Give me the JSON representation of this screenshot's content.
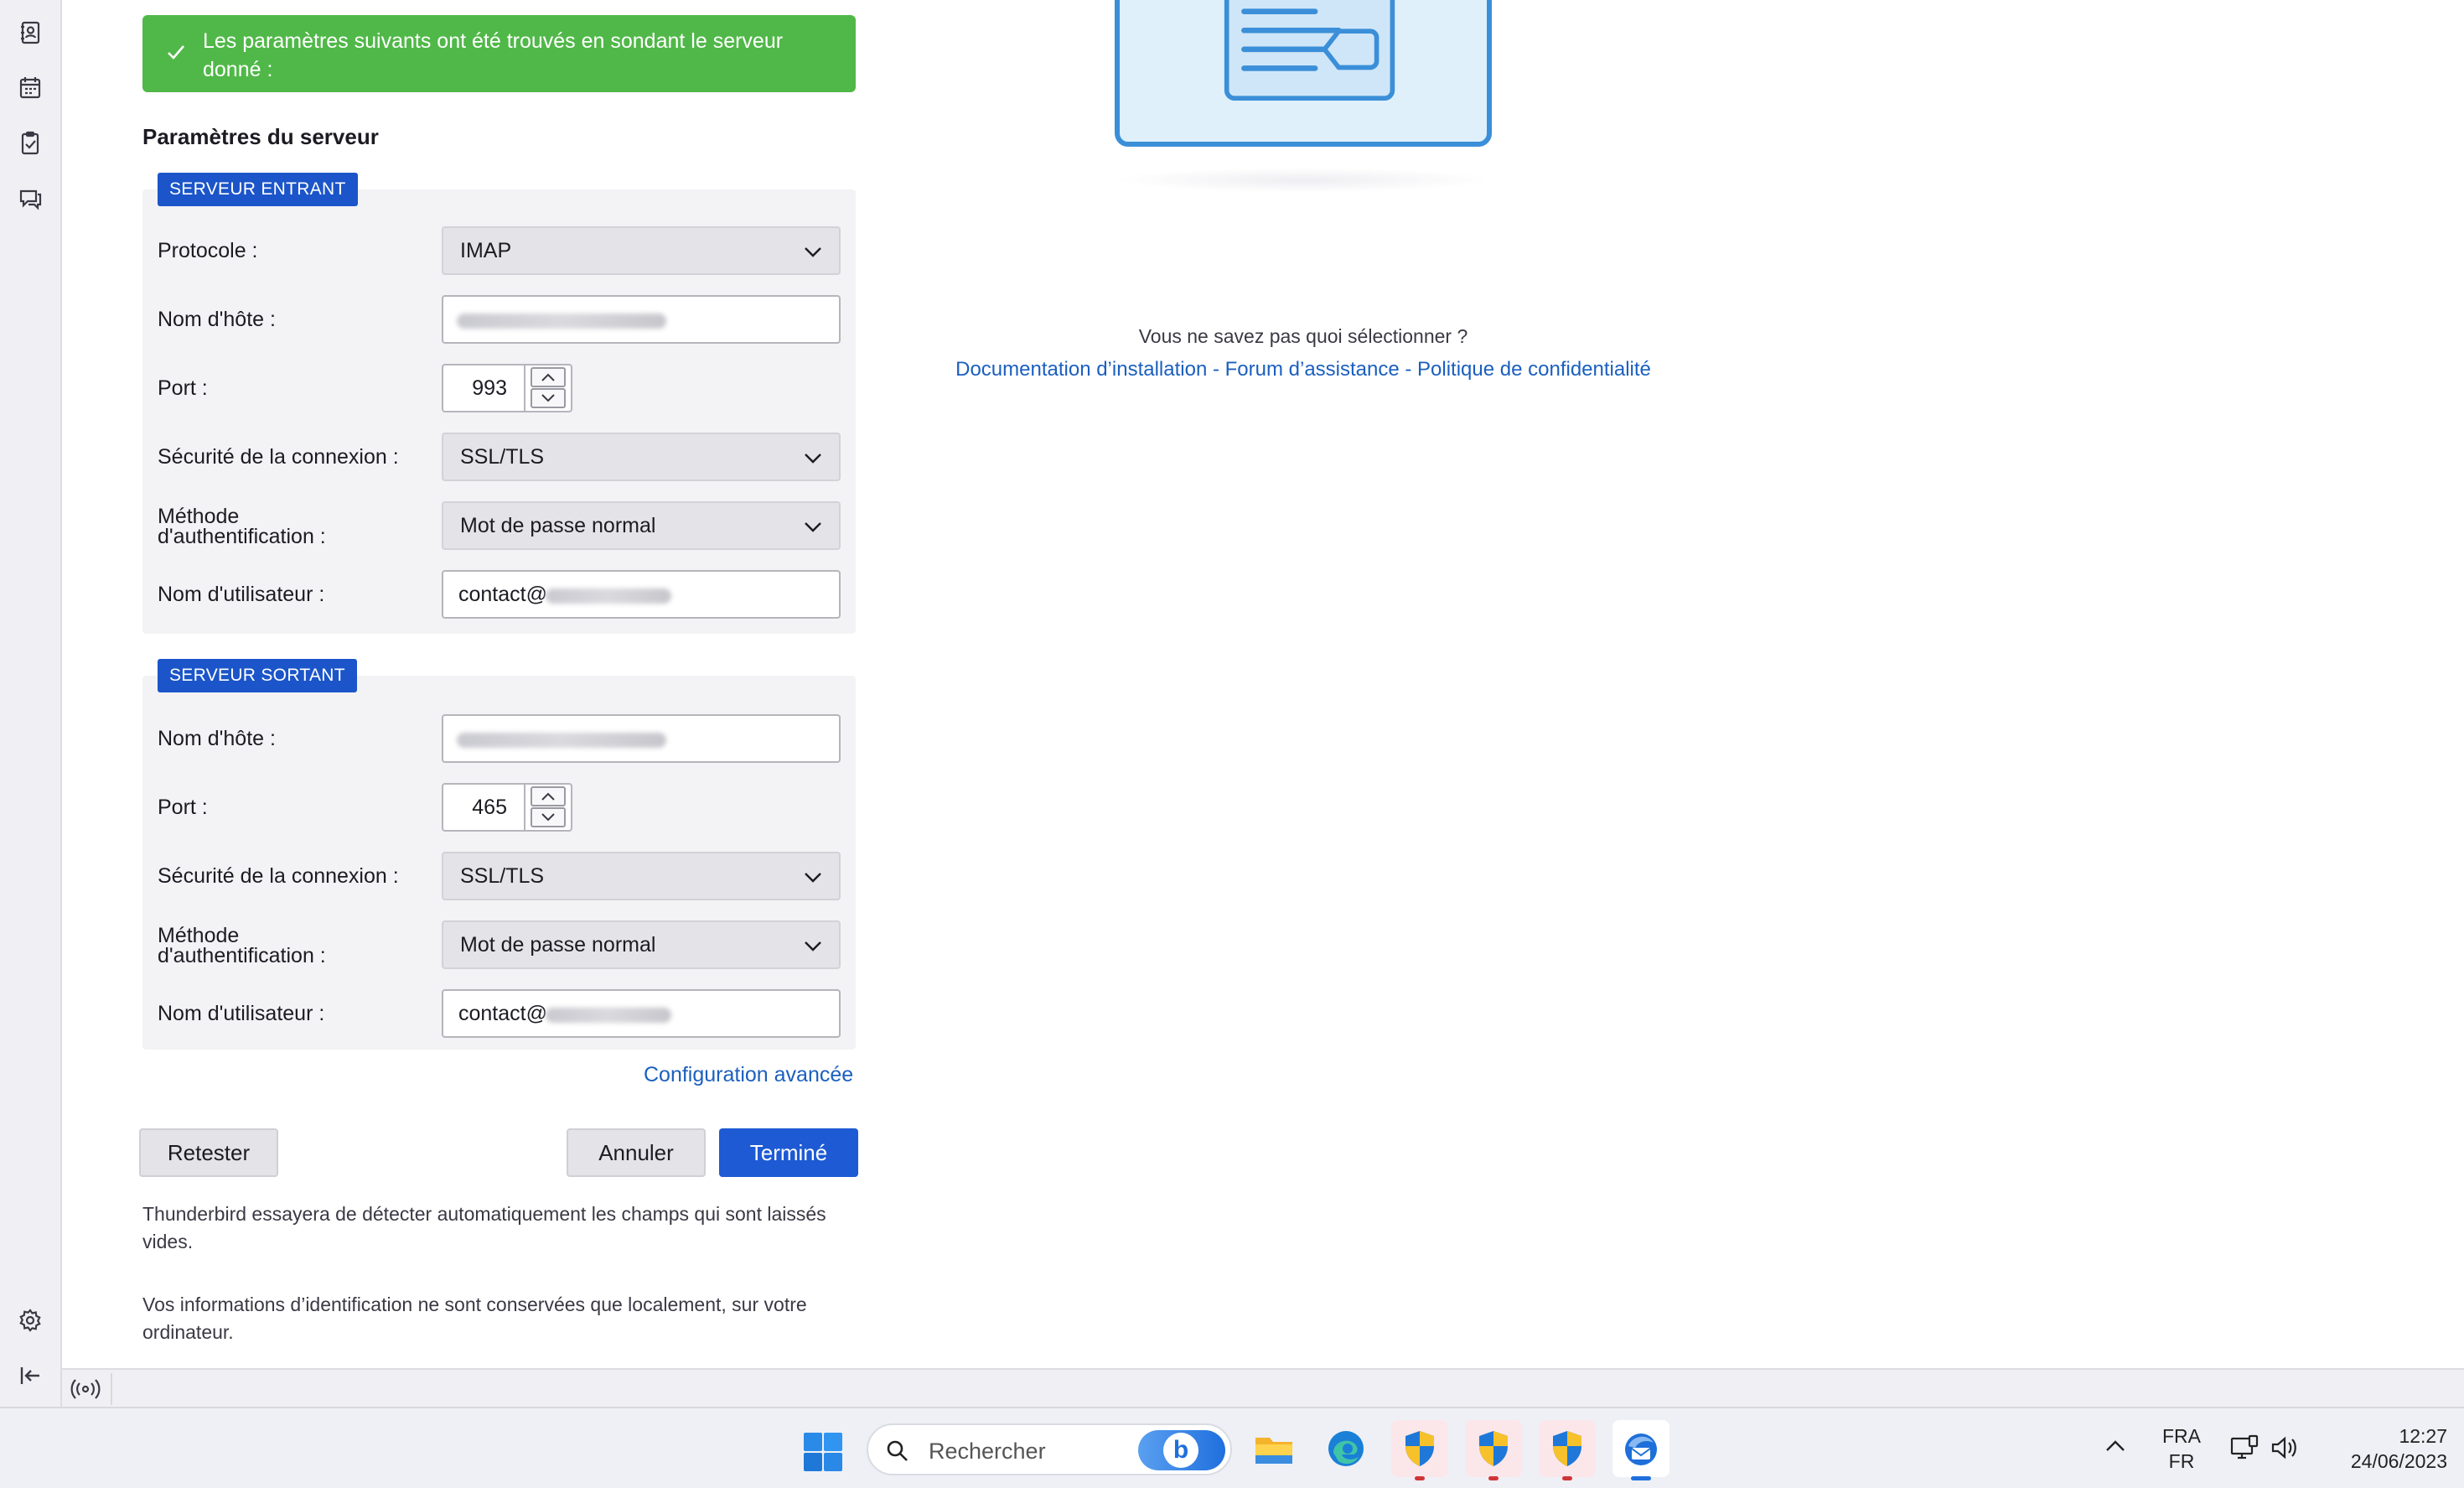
{
  "notification": {
    "message": "Les paramètres suivants ont été trouvés en sondant le serveur donné :",
    "color": "#50b848"
  },
  "server_settings": {
    "title": "Paramètres du serveur",
    "incoming": {
      "badge": "SERVEUR ENTRANT",
      "protocol_label": "Protocole :",
      "protocol_value": "IMAP",
      "hostname_label": "Nom d'hôte :",
      "hostname_value": "",
      "port_label": "Port :",
      "port_value": "993",
      "security_label": "Sécurité de la connexion :",
      "security_value": "SSL/TLS",
      "auth_label_line1": "Méthode",
      "auth_label_line2": "d'authentification :",
      "auth_value": "Mot de passe normal",
      "username_label": "Nom d'utilisateur :",
      "username_value": "contact@"
    },
    "outgoing": {
      "badge": "SERVEUR SORTANT",
      "hostname_label": "Nom d'hôte :",
      "hostname_value": "",
      "port_label": "Port :",
      "port_value": "465",
      "security_label": "Sécurité de la connexion :",
      "security_value": "SSL/TLS",
      "auth_label_line1": "Méthode",
      "auth_label_line2": "d'authentification :",
      "auth_value": "Mot de passe normal",
      "username_label": "Nom d'utilisateur :",
      "username_value": "contact@"
    },
    "advanced_link": "Configuration avancée"
  },
  "buttons": {
    "retest": "Retester",
    "cancel": "Annuler",
    "done": "Terminé"
  },
  "notes": {
    "autodetect": "Thunderbird essayera de détecter automatiquement les champs qui sont laissés vides.",
    "credentials": "Vos informations d’identification ne sont conservées que localement, sur votre ordinateur."
  },
  "help": {
    "question": "Vous ne savez pas quoi sélectionner ?",
    "link_install": "Documentation d’installation",
    "link_forum": "Forum d’assistance",
    "link_privacy": "Politique de confidentialité",
    "separator": " - "
  },
  "taskbar": {
    "search_placeholder": "Rechercher",
    "bing_letter": "b",
    "lang_top": "FRA",
    "lang_bottom": "FR",
    "time": "12:27",
    "date": "24/06/2023"
  },
  "icons": {
    "spaces": [
      "address-book-icon",
      "calendar-icon",
      "tasks-icon",
      "chat-icon",
      "settings-icon",
      "collapse-icon"
    ],
    "taskbar": [
      "windows-start-icon",
      "search-icon",
      "bing-icon",
      "file-explorer-icon",
      "edge-icon",
      "shield-icon",
      "thunderbird-icon"
    ]
  },
  "colors": {
    "accent": "#1d5ad4",
    "badge": "#1b55c9",
    "link": "#1b5fbf",
    "success": "#50b848"
  }
}
